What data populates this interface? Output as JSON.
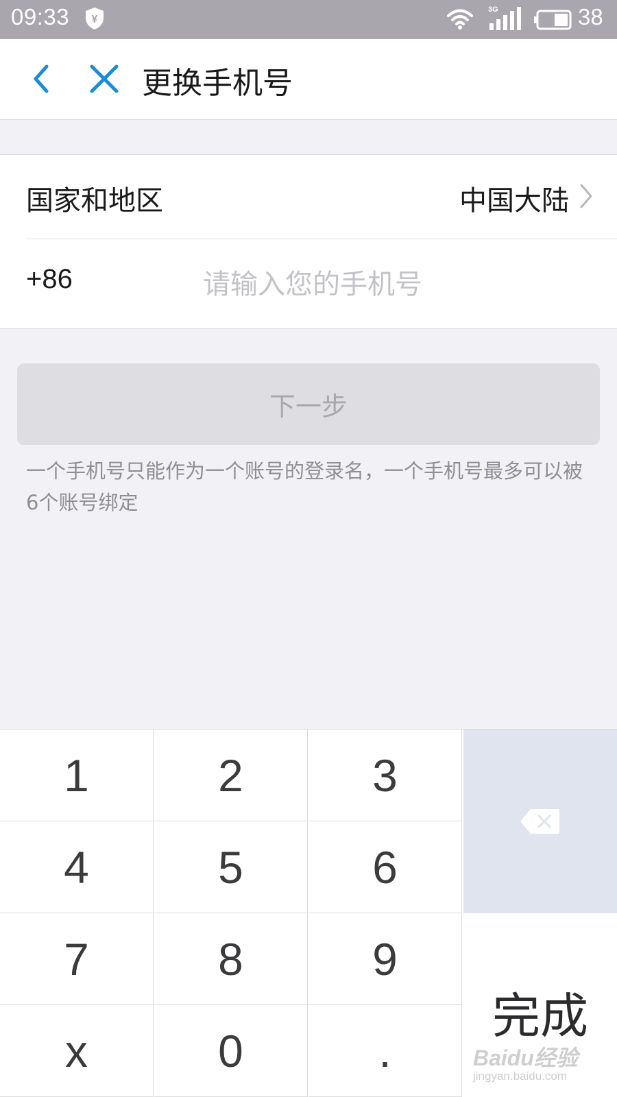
{
  "status_bar": {
    "time": "09:33",
    "shield_glyph": "¥",
    "network": "3G",
    "battery": "38"
  },
  "nav": {
    "title": "更换手机号",
    "accent_color": "#1a8bd5"
  },
  "form": {
    "region_label": "国家和地区",
    "region_value": "中国大陆",
    "country_code": "+86",
    "phone_placeholder": "请输入您的手机号",
    "phone_value": ""
  },
  "next_button": {
    "label": "下一步"
  },
  "hint": "一个手机号只能作为一个账号的登录名，一个手机号最多可以被6个账号绑定",
  "keypad": {
    "keys": [
      "1",
      "2",
      "3",
      "4",
      "5",
      "6",
      "7",
      "8",
      "9",
      "x",
      "0",
      "."
    ],
    "delete_icon": "backspace-icon",
    "done_label": "完成"
  },
  "watermark": {
    "brand": "Baidu经验",
    "url": "jingyan.baidu.com"
  }
}
